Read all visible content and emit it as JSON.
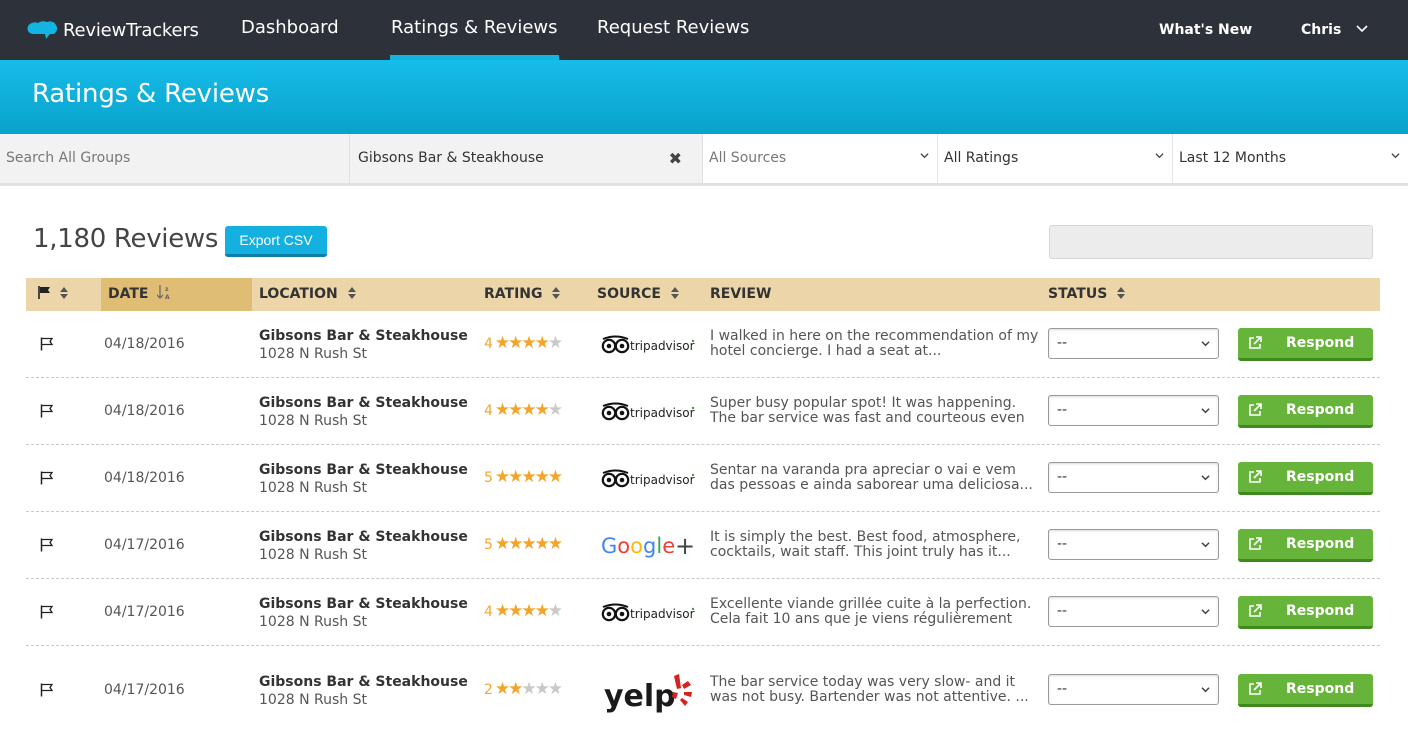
{
  "app": {
    "logo_text": "ReviewTrackers"
  },
  "nav": {
    "dashboard": "Dashboard",
    "ratings": "Ratings & Reviews",
    "request": "Request Reviews",
    "whats_new": "What's New",
    "user": "Chris"
  },
  "page": {
    "title": "Ratings & Reviews"
  },
  "filters": {
    "search_placeholder": "Search All Groups",
    "group_value": "Gibsons Bar & Steakhouse",
    "sources": "All Sources",
    "ratings": "All Ratings",
    "period": "Last 12 Months"
  },
  "summary": {
    "count": "1,180 Reviews",
    "export_label": "Export CSV"
  },
  "table": {
    "headers": {
      "date": "DATE",
      "location": "LOCATION",
      "rating": "RATING",
      "source": "SOURCE",
      "review": "REVIEW",
      "status": "STATUS"
    },
    "rows": [
      {
        "date": "04/18/2016",
        "location": "Gibsons Bar & Steakhouse",
        "address": "1028 N Rush St",
        "rating": 4,
        "source": "tripadvisor",
        "review": "I walked in here on the recommendation of my hotel concierge. I had a seat at...",
        "status": "--",
        "action": "Respond"
      },
      {
        "date": "04/18/2016",
        "location": "Gibsons Bar & Steakhouse",
        "address": "1028 N Rush St",
        "rating": 4,
        "source": "tripadvisor",
        "review": "Super busy popular spot! It was happening. The bar service was fast and courteous even though...",
        "status": "--",
        "action": "Respond"
      },
      {
        "date": "04/18/2016",
        "location": "Gibsons Bar & Steakhouse",
        "address": "1028 N Rush St",
        "rating": 5,
        "source": "tripadvisor",
        "review": "Sentar na varanda pra apreciar o vai e vem das pessoas e ainda saborear uma deliciosa...",
        "status": "--",
        "action": "Respond"
      },
      {
        "date": "04/17/2016",
        "location": "Gibsons Bar & Steakhouse",
        "address": "1028 N Rush St",
        "rating": 5,
        "source": "google-plus",
        "review": "It is simply the best. Best food, atmosphere, cocktails, wait staff. This joint truly has it...",
        "status": "--",
        "action": "Respond"
      },
      {
        "date": "04/17/2016",
        "location": "Gibsons Bar & Steakhouse",
        "address": "1028 N Rush St",
        "rating": 4,
        "source": "tripadvisor",
        "review": "Excellente viande grillée cuite à la perfection. Cela fait 10 ans que je viens régulièrement aux...",
        "status": "--",
        "action": "Respond"
      },
      {
        "date": "04/17/2016",
        "location": "Gibsons Bar & Steakhouse",
        "address": "1028 N Rush St",
        "rating": 2,
        "source": "yelp",
        "review": "The bar service today was very slow- and it was not busy. Bartender was not attentive.  ...",
        "status": "--",
        "action": "Respond"
      }
    ]
  },
  "brand": {
    "tripadvisor": "tripadvisor",
    "google": "Google",
    "google_plus": "+",
    "yelp": "yelp"
  },
  "colors": {
    "nav_bg": "#2d3139",
    "accent": "#12b4e2",
    "header_row": "#ecd6a9",
    "star": "#f3a52a",
    "respond": "#67b43a"
  }
}
